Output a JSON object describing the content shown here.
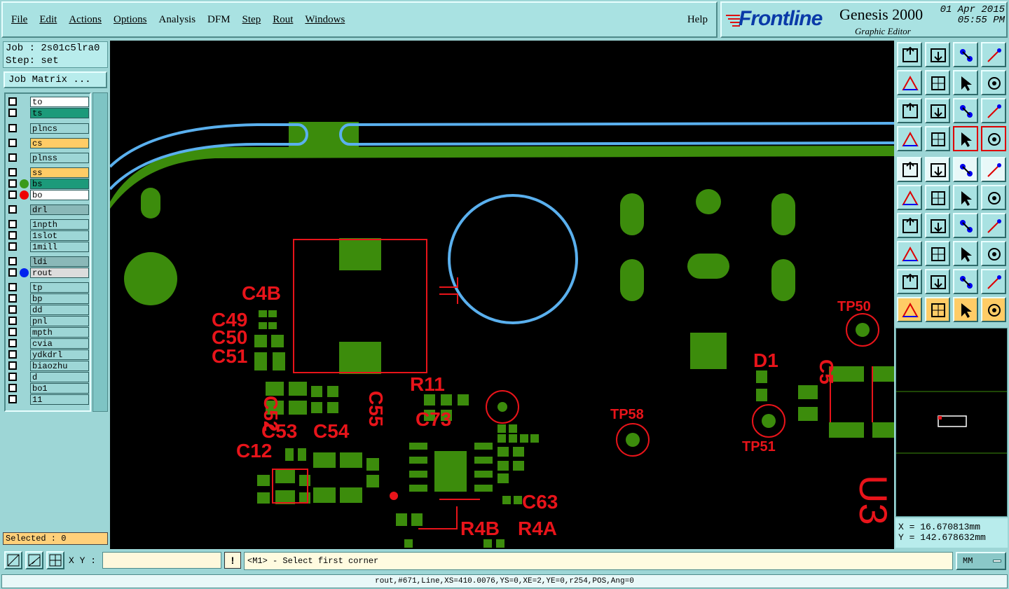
{
  "menu": {
    "items": [
      "File",
      "Edit",
      "Actions",
      "Options",
      "Analysis",
      "DFM",
      "Step",
      "Rout",
      "Windows"
    ],
    "help": "Help"
  },
  "brand": {
    "logo": "Frontline",
    "product": "Genesis 2000",
    "subtitle": "Graphic Editor",
    "date": "01 Apr 2015",
    "time": "05:55 PM"
  },
  "job": {
    "job_line": "Job : 2s01c5lra0",
    "step_line": "Step: set",
    "matrix_button": "Job Matrix ..."
  },
  "layers": [
    {
      "name": "to",
      "bg": "#ffffff",
      "dot": ""
    },
    {
      "name": "ts",
      "bg": "#1c9a7a",
      "dot": ""
    },
    {
      "name": "plncs",
      "bg": "#9dd6d6",
      "dot": ""
    },
    {
      "name": "cs",
      "bg": "#ffcc66",
      "dot": ""
    },
    {
      "name": "plnss",
      "bg": "#9dd6d6",
      "dot": ""
    },
    {
      "name": "ss",
      "bg": "#ffcc66",
      "dot": ""
    },
    {
      "name": "bs",
      "bg": "#1c9a7a",
      "dot": "#3a9a1a"
    },
    {
      "name": "bo",
      "bg": "#ffffff",
      "dot": "#ee0000"
    },
    {
      "name": "drl",
      "bg": "#8ab8b8",
      "dot": ""
    },
    {
      "name": "1npth",
      "bg": "#9dd6d6",
      "dot": ""
    },
    {
      "name": "1slot",
      "bg": "#9dd6d6",
      "dot": ""
    },
    {
      "name": "1mill",
      "bg": "#9dd6d6",
      "dot": ""
    },
    {
      "name": "ldi",
      "bg": "#8ab8b8",
      "dot": ""
    },
    {
      "name": "rout",
      "bg": "#dcdcdc",
      "dot": "#0022ee"
    },
    {
      "name": "tp",
      "bg": "#9dd6d6",
      "dot": ""
    },
    {
      "name": "bp",
      "bg": "#9dd6d6",
      "dot": ""
    },
    {
      "name": "dd",
      "bg": "#9dd6d6",
      "dot": ""
    },
    {
      "name": "pnl",
      "bg": "#9dd6d6",
      "dot": ""
    },
    {
      "name": "mpth",
      "bg": "#9dd6d6",
      "dot": ""
    },
    {
      "name": "cvia",
      "bg": "#9dd6d6",
      "dot": ""
    },
    {
      "name": "ydkdrl",
      "bg": "#9dd6d6",
      "dot": ""
    },
    {
      "name": "biaozhu",
      "bg": "#9dd6d6",
      "dot": ""
    },
    {
      "name": "d",
      "bg": "#9dd6d6",
      "dot": ""
    },
    {
      "name": "bo1",
      "bg": "#9dd6d6",
      "dot": ""
    },
    {
      "name": "11",
      "bg": "#9dd6d6",
      "dot": ""
    }
  ],
  "selected": "Selected : 0",
  "canvas_labels": [
    "C4B",
    "C49",
    "C50",
    "C51",
    "C52",
    "C53",
    "C54",
    "C55",
    "C12",
    "R11",
    "C73",
    "TP58",
    "TP51",
    "TP50",
    "D1",
    "C5",
    "C63",
    "R4A",
    "R4B"
  ],
  "coords": {
    "x": "X = 16.670813mm",
    "y": "Y = 142.678632mm"
  },
  "bottom": {
    "xy_label": "X Y :",
    "xy_value": "",
    "warn": "!",
    "prompt": "<M1> - Select first corner",
    "unit": "MM"
  },
  "status": "rout,#671,Line,XS=410.0076,YS=0,XE=2,YE=0,r254,POS,Ang=0",
  "colors": {
    "copper": "#3c8c0c",
    "silkscreen": "#e8141a",
    "rout": "#5ab0ee",
    "panel": "#9dd6d6"
  },
  "tools": [
    "zoom-home-icon",
    "page-down-icon",
    "house-icon",
    "window-icon",
    "pan-left-icon",
    "pan-right-icon",
    "rotate-icon",
    "flip-icon",
    "fit-icon",
    "center-icon",
    "scale-icon",
    "help-icon",
    "tool-settings-icon",
    "key-icon",
    "layers-toggle-icon",
    "snap-toggle-icon",
    "fill-icon",
    "transform-icon",
    "ruler-icon",
    "round-pad-icon",
    "connect-icon",
    "cross-icon",
    "line-icon",
    "point-icon",
    "line-edit-icon",
    "line-draw-icon",
    "arc-icon",
    "split-icon",
    "pad-place-icon",
    "dash-icon",
    "measure-icon",
    "component-icon",
    "triangle-icon",
    "arch-icon",
    "angle-icon",
    "bridge-icon",
    "select-arrow-icon",
    "select-box-icon",
    "select-red-icon",
    "select-net-icon"
  ]
}
